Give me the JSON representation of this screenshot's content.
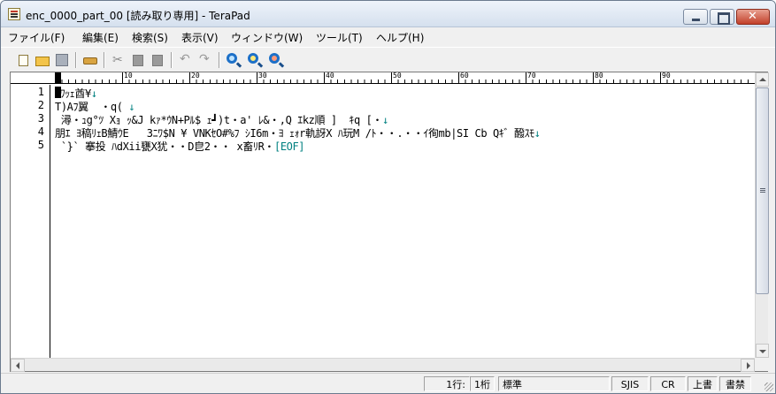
{
  "window": {
    "title": "enc_0000_part_00 [読み取り専用] - TeraPad"
  },
  "menu": [
    "ファイル(F)",
    "編集(E)",
    "検索(S)",
    "表示(V)",
    "ウィンドウ(W)",
    "ツール(T)",
    "ヘルプ(H)"
  ],
  "toolbar": {
    "icons": [
      "new-file-icon",
      "open-folder-icon",
      "save-icon",
      "print-icon",
      "cut-icon",
      "copy-icon",
      "paste-icon",
      "undo-icon",
      "redo-icon",
      "find-icon",
      "find-next-icon",
      "find-prev-icon"
    ]
  },
  "ruler": {
    "labels": [
      "0",
      "10",
      "20",
      "30",
      "40",
      "50",
      "60",
      "70",
      "80",
      "90"
    ]
  },
  "editor": {
    "line_numbers": [
      "1",
      "2",
      "3",
      "4",
      "5"
    ],
    "lines": [
      "ﾂﾜｯｪ酋¥",
      "T)Aﾌ翼  ・q( ",
      " 潯・ｭg°ﾂ Xｮ ｯ&J kｧ*ｳN+Pﾙ$ ｪ┛)t・a' ﾚ&・,Q ｴkz順 ]  ｷq [・",
      "朋ｴ ﾖ稿ﾘｪB鯖ｳE   3ﾆﾜ$N ¥ VNKｾO#%ﾌ ｼI6m・ﾖ ｪｫr軌訝X ﾊ玩M /ﾄ・・.・・ｲ徇mb|SI Cb Qｷ゛醱ｽﾓ",
      " `}` 搴投 ﾊdXii甕X犹・・D皀2・・ x畜ﾘR・"
    ],
    "eol_mark": "↓",
    "eof_mark": "[EOF]"
  },
  "status": {
    "line": "1行:",
    "column": "1桁",
    "mode": "標準",
    "encoding": "SJIS",
    "newline": "CR",
    "overwrite": "上書",
    "readonly": "書禁"
  }
}
